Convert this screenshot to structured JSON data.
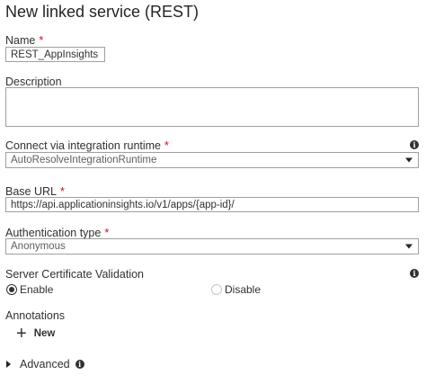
{
  "panel": {
    "title": "New linked service (REST)"
  },
  "fields": {
    "name": {
      "label": "Name",
      "required": "*",
      "value": "REST_AppInsights"
    },
    "description": {
      "label": "Description",
      "value": ""
    },
    "runtime": {
      "label": "Connect via integration runtime",
      "required": "*",
      "value": "AutoResolveIntegrationRuntime",
      "icon": "info-icon"
    },
    "base_url": {
      "label": "Base URL",
      "required": "*",
      "value": "https://api.applicationinsights.io/v1/apps/{app-id}/"
    },
    "auth_type": {
      "label": "Authentication type",
      "required": "*",
      "value": "Anonymous"
    },
    "cert_validation": {
      "label": "Server Certificate Validation",
      "icon": "info-icon",
      "options": [
        "Enable",
        "Disable"
      ],
      "selected": "Enable"
    }
  },
  "annotations": {
    "label": "Annotations",
    "new_label": "New"
  },
  "advanced": {
    "label": "Advanced",
    "icon": "info-icon"
  }
}
